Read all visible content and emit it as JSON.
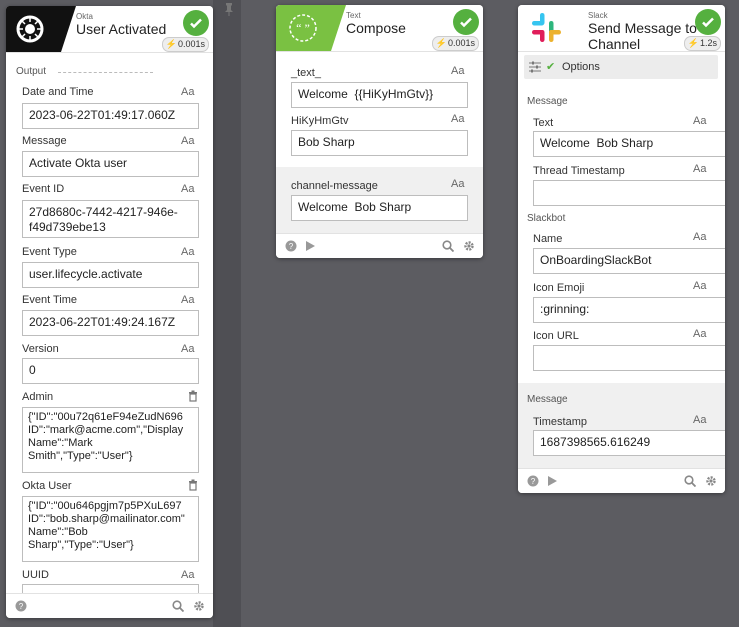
{
  "cards": {
    "okta": {
      "kicker": "Okta",
      "title": "User Activated",
      "timer": "0.001s",
      "section": "Output",
      "fields": [
        {
          "label": "Date and Time",
          "value": "2023-06-22T01:49:17.060Z"
        },
        {
          "label": "Message",
          "value": "Activate Okta user"
        },
        {
          "label": "Event ID",
          "value": "27d8680c-7442-4217-946e-\nf49d739ebe13"
        },
        {
          "label": "Event Type",
          "value": "user.lifecycle.activate"
        },
        {
          "label": "Event Time",
          "value": "2023-06-22T01:49:24.167Z"
        },
        {
          "label": "Version",
          "value": "0"
        },
        {
          "label": "Admin",
          "value": "{\"ID\":\"00u72q61eF94eZudN696\nID\":\"mark@acme.com\",\"Display\nName\":\"Mark\nSmith\",\"Type\":\"User\"}"
        },
        {
          "label": "Okta User",
          "value": "{\"ID\":\"00u646pgjm7p5PXuL697\nID\":\"bob.sharp@mailinator.com\"\nName\":\"Bob\nSharp\",\"Type\":\"User\"}"
        },
        {
          "label": "UUID",
          "value": ""
        }
      ]
    },
    "text": {
      "kicker": "Text",
      "title": "Compose",
      "timer": "0.001s",
      "fields": [
        {
          "label": "_text_",
          "value": "Welcome  {{HiKyHmGtv}}"
        },
        {
          "label": "HiKyHmGtv",
          "value": "Bob Sharp"
        },
        {
          "label": "channel-message",
          "value": "Welcome  Bob Sharp"
        }
      ]
    },
    "slack": {
      "kicker": "Slack",
      "title_line1": "Send Message to",
      "title_line2": "Channel",
      "timer": "1.2s",
      "options_label": "Options",
      "section_message": "Message",
      "section_slackbot": "Slackbot",
      "section_message2": "Message",
      "fields": [
        {
          "label": "Text",
          "value": "Welcome  Bob Sharp"
        },
        {
          "label": "Thread Timestamp",
          "value": ""
        },
        {
          "label": "Name",
          "value": "OnBoardingSlackBot"
        },
        {
          "label": "Icon Emoji",
          "value": ":grinning:"
        },
        {
          "label": "Icon URL",
          "value": ""
        },
        {
          "label": "Timestamp",
          "value": "1687398565.616249"
        }
      ]
    }
  },
  "aa_label": "Aa",
  "colors": {
    "success": "#55b03f",
    "text_header": "#7ac142",
    "okta_header": "#111111"
  },
  "icons": [
    "okta-logo-icon",
    "quote-icon",
    "slack-logo-icon",
    "check-icon",
    "bolt-icon",
    "help-icon",
    "play-icon",
    "search-icon",
    "gear-icon",
    "trash-icon",
    "pin-icon",
    "sliders-icon"
  ]
}
